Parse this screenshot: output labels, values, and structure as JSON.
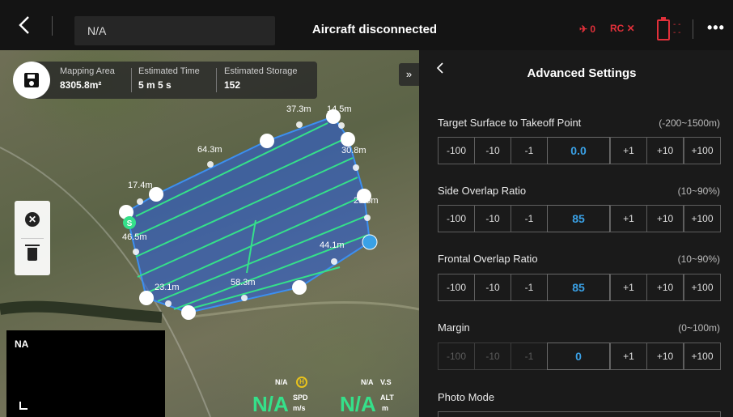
{
  "topbar": {
    "field_value": "N/A",
    "status_title": "Aircraft disconnected",
    "drone_status": "✈ 0",
    "rc_status": "RC ✕",
    "battery_value": "- -\n- -",
    "more_label": "•••"
  },
  "map": {
    "mapping_area_label": "Mapping Area",
    "mapping_area_value": "8305.8m²",
    "estimated_time_label": "Estimated Time",
    "estimated_time_value": "5 m 5 s",
    "estimated_storage_label": "Estimated Storage",
    "estimated_storage_value": "152",
    "collapse_label": "»",
    "edge_labels": [
      "37.3m",
      "14.5m",
      "64.3m",
      "30.8m",
      "17.4m",
      "23.5m",
      "46.5m",
      "44.1m",
      "23.1m",
      "58.3m"
    ],
    "start_marker": "S",
    "fpv_label": "NA",
    "telemetry": {
      "home_na": "N/A",
      "home_icon": "H",
      "vs_na": "N/A",
      "vs_label": "V.S",
      "spd_value": "N/A",
      "spd_label": "SPD",
      "spd_unit": "m/s",
      "alt_value": "N/A",
      "alt_label": "ALT",
      "alt_unit": "m"
    }
  },
  "panel": {
    "title": "Advanced Settings",
    "rows": [
      {
        "label": "Target Surface to Takeoff Point",
        "range": "(-200~1500m)",
        "value": "0.0",
        "dec": [
          "-100",
          "-10",
          "-1"
        ],
        "inc": [
          "+1",
          "+10",
          "+100"
        ],
        "dec_disabled": false
      },
      {
        "label": "Side Overlap Ratio",
        "range": "(10~90%)",
        "value": "85",
        "dec": [
          "-100",
          "-10",
          "-1"
        ],
        "inc": [
          "+1",
          "+10",
          "+100"
        ],
        "dec_disabled": false
      },
      {
        "label": "Frontal Overlap Ratio",
        "range": "(10~90%)",
        "value": "85",
        "dec": [
          "-100",
          "-10",
          "-1"
        ],
        "inc": [
          "+1",
          "+10",
          "+100"
        ],
        "dec_disabled": false
      },
      {
        "label": "Margin",
        "range": "(0~100m)",
        "value": "0",
        "dec": [
          "-100",
          "-10",
          "-1"
        ],
        "inc": [
          "+1",
          "+10",
          "+100"
        ],
        "dec_disabled": true
      }
    ],
    "photo_mode_label": "Photo Mode"
  },
  "colors": {
    "accent_blue": "#3aa1e6",
    "route_green": "#35e08a",
    "error_red": "#e0303a",
    "area_fill": "#2f5fd0"
  }
}
